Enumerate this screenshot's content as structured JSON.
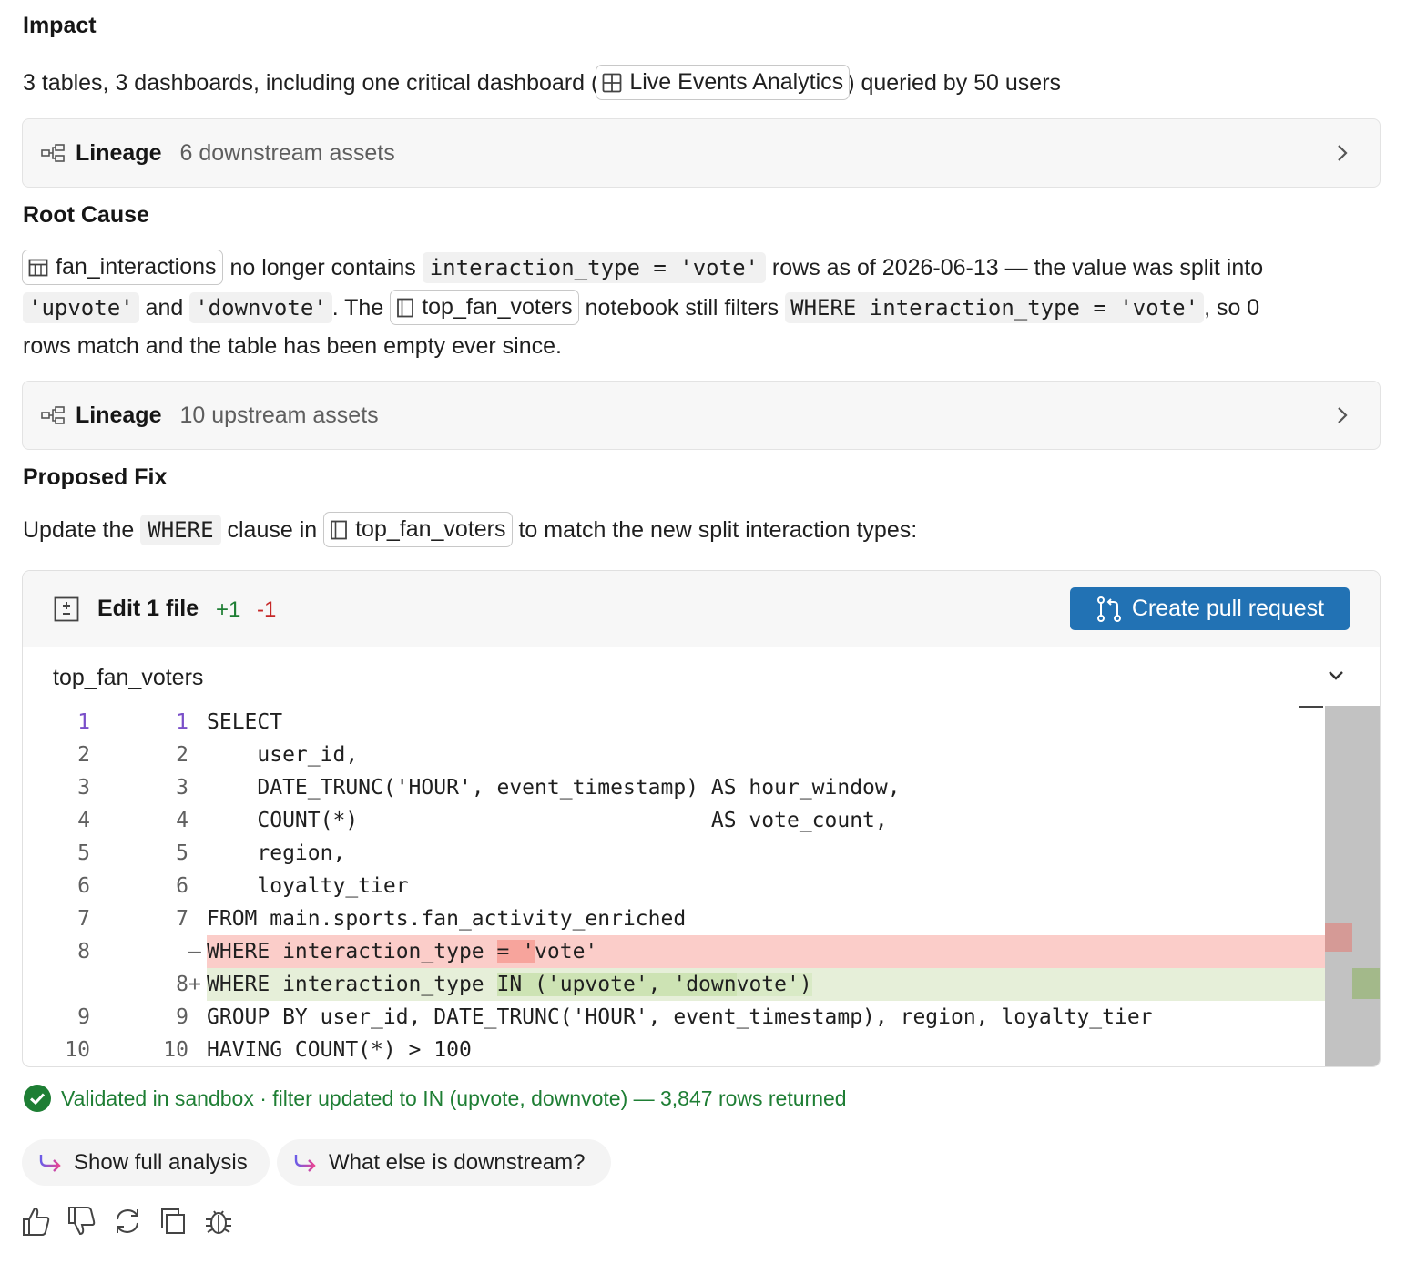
{
  "impact": {
    "heading": "Impact",
    "text_before": "3 tables, 3 dashboards, including one critical dashboard (",
    "dashboard_chip": "Live Events Analytics",
    "text_after": ") queried by 50 users"
  },
  "lineage_downstream": {
    "title": "Lineage",
    "subtitle": "6 downstream assets"
  },
  "root_cause": {
    "heading": "Root Cause",
    "table_chip": "fan_interactions",
    "t1": "no longer contains",
    "code1": "interaction_type = 'vote'",
    "t2": "rows as of 2026-06-13 — the value was split into",
    "code2": "'upvote'",
    "t3": "and",
    "code3": "'downvote'",
    "t4": ". The",
    "notebook_chip": "top_fan_voters",
    "t5": "notebook still filters",
    "code4": "WHERE interaction_type = 'vote'",
    "t6": ", so 0",
    "t7": "rows match and the table has been empty ever since."
  },
  "lineage_upstream": {
    "title": "Lineage",
    "subtitle": "10 upstream assets"
  },
  "proposed_fix": {
    "heading": "Proposed Fix",
    "t1": "Update the",
    "code1": "WHERE",
    "t2": "clause in",
    "notebook_chip": "top_fan_voters",
    "t3": "to match the new split interaction types:"
  },
  "editor": {
    "title": "Edit 1 file",
    "additions": "+1",
    "deletions": "-1",
    "pr_button": "Create pull request",
    "filename": "top_fan_voters",
    "lines": [
      {
        "old": "1",
        "new": "1",
        "mark": "",
        "text": "SELECT"
      },
      {
        "old": "2",
        "new": "2",
        "mark": "",
        "text": "    user_id,"
      },
      {
        "old": "3",
        "new": "3",
        "mark": "",
        "text": "    DATE_TRUNC('HOUR', event_timestamp) AS hour_window,"
      },
      {
        "old": "4",
        "new": "4",
        "mark": "",
        "text": "    COUNT(*)                            AS vote_count,"
      },
      {
        "old": "5",
        "new": "5",
        "mark": "",
        "text": "    region,"
      },
      {
        "old": "6",
        "new": "6",
        "mark": "",
        "text": "    loyalty_tier"
      },
      {
        "old": "7",
        "new": "7",
        "mark": "",
        "text": "FROM main.sports.fan_activity_enriched"
      },
      {
        "old": "8",
        "new": "",
        "mark": "—",
        "text": ""
      },
      {
        "old": "",
        "new": "8",
        "mark": "+",
        "text": ""
      },
      {
        "old": "9",
        "new": "9",
        "mark": "",
        "text": "GROUP BY user_id, DATE_TRUNC('HOUR', event_timestamp), region, loyalty_tier"
      },
      {
        "old": "10",
        "new": "10",
        "mark": "",
        "text": "HAVING COUNT(*) > 100"
      }
    ],
    "del_line": {
      "a": "WHERE interaction_type ",
      "b": "= '",
      "c": "vote'"
    },
    "add_line": {
      "a": "WHERE interaction_type ",
      "b": "IN ('upvote', 'down",
      "c": "vote')"
    }
  },
  "status": "Validated in sandbox · filter updated to IN (upvote, downvote) — 3,847 rows returned",
  "suggestions": [
    "Show full analysis",
    "What else is downstream?"
  ],
  "colors": {
    "accent": "#2272b4",
    "success": "#1e7e34",
    "add": "#1e7e34",
    "del": "#c62828"
  }
}
